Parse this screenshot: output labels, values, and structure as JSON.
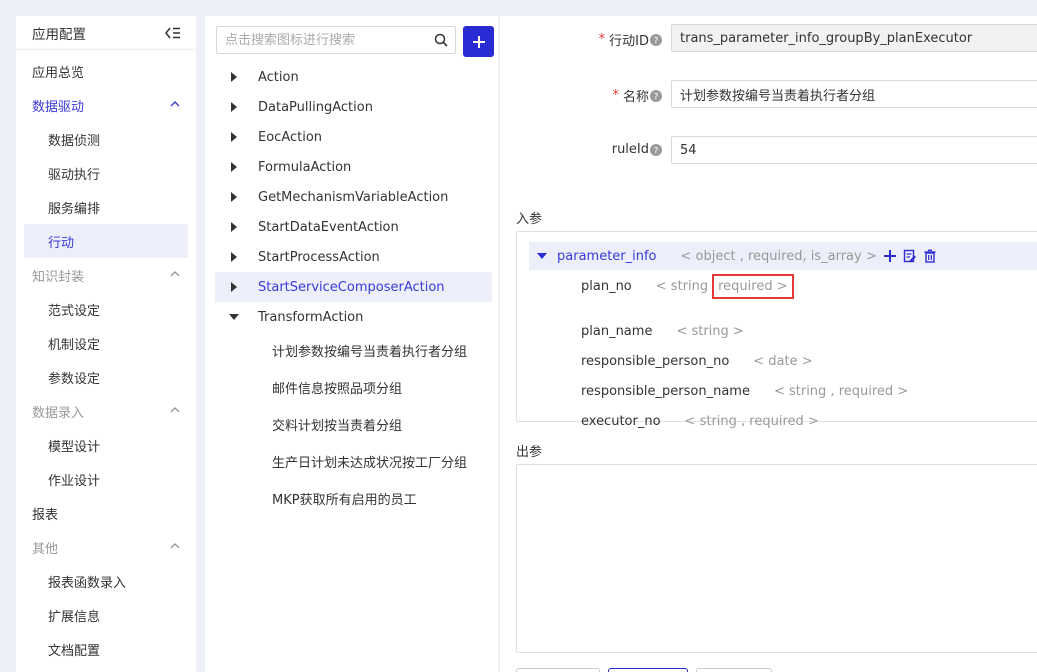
{
  "sidebar": {
    "title": "应用配置",
    "items": [
      {
        "label": "应用总览",
        "kind": "item"
      },
      {
        "label": "数据驱动",
        "kind": "group-active"
      },
      {
        "label": "数据侦测",
        "kind": "sub"
      },
      {
        "label": "驱动执行",
        "kind": "sub"
      },
      {
        "label": "服务编排",
        "kind": "sub"
      },
      {
        "label": "行动",
        "kind": "active"
      },
      {
        "label": "知识封装",
        "kind": "group"
      },
      {
        "label": "范式设定",
        "kind": "sub"
      },
      {
        "label": "机制设定",
        "kind": "sub"
      },
      {
        "label": "参数设定",
        "kind": "sub"
      },
      {
        "label": "数据录入",
        "kind": "group"
      },
      {
        "label": "模型设计",
        "kind": "sub"
      },
      {
        "label": "作业设计",
        "kind": "sub"
      },
      {
        "label": "报表",
        "kind": "item"
      },
      {
        "label": "其他",
        "kind": "group"
      },
      {
        "label": "报表函数录入",
        "kind": "sub"
      },
      {
        "label": "扩展信息",
        "kind": "sub"
      },
      {
        "label": "文档配置",
        "kind": "sub"
      }
    ]
  },
  "search": {
    "placeholder": "点击搜索图标进行搜索",
    "value": ""
  },
  "tree": {
    "nodes": [
      {
        "label": "Action",
        "expanded": false
      },
      {
        "label": "DataPullingAction",
        "expanded": false
      },
      {
        "label": "EocAction",
        "expanded": false
      },
      {
        "label": "FormulaAction",
        "expanded": false
      },
      {
        "label": "GetMechanismVariableAction",
        "expanded": false
      },
      {
        "label": "StartDataEventAction",
        "expanded": false
      },
      {
        "label": "StartProcessAction",
        "expanded": false
      },
      {
        "label": "StartServiceComposerAction",
        "expanded": false,
        "selected": true
      },
      {
        "label": "TransformAction",
        "expanded": true
      }
    ],
    "children": [
      "计划参数按编号当责着执行者分组",
      "邮件信息按照品项分组",
      "交料计划按当责着分组",
      "生产日计划未达成状况按工厂分组",
      "MKP获取所有启用的员工"
    ]
  },
  "form": {
    "action_id_label": "行动ID",
    "action_id_value": "trans_parameter_info_groupBy_planExecutor",
    "name_label": "名称",
    "name_value": "计划参数按编号当责着执行者分组",
    "rule_id_label": "ruleId",
    "rule_id_value": "54"
  },
  "params": {
    "input_title": "入参",
    "output_title": "出参",
    "root_name": "parameter_info",
    "root_meta": "< object , required, is_array >",
    "fields": [
      {
        "name": "plan_no",
        "meta_pre": "< string",
        "meta_hl": "required >"
      },
      {
        "name": "plan_name",
        "meta_pre": "< string >",
        "meta_hl": ""
      },
      {
        "name": "responsible_person_no",
        "meta_pre": "< date >",
        "meta_hl": ""
      },
      {
        "name": "responsible_person_name",
        "meta_pre": "< string , required >",
        "meta_hl": ""
      },
      {
        "name": "executor_no",
        "meta_pre": "< string , required >",
        "meta_hl": ""
      }
    ]
  },
  "colors": {
    "accent": "#2b2bd4",
    "active_bg": "#eceefa",
    "highlight_box": "#e53935",
    "required_star": "#e53935"
  }
}
